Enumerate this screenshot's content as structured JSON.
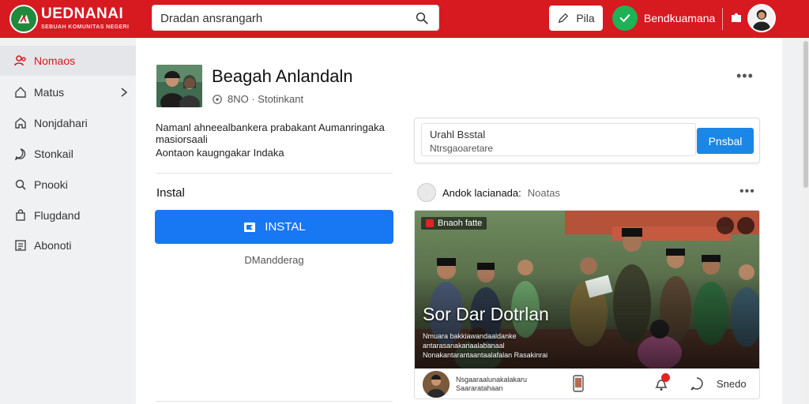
{
  "header": {
    "logo_title": "UEDNANAI",
    "logo_sub": "SEBUAH KOMUNITAS NEGERI",
    "search_placeholder": "Dradan ansrangarh",
    "pin_label": "Pila",
    "status_label": "Bendkuamana",
    "accent_color": "#d71920"
  },
  "sidebar": {
    "items": [
      {
        "label": "Nomaos",
        "icon": "people-icon",
        "active": true
      },
      {
        "label": "Matus",
        "icon": "home-icon",
        "active": false
      },
      {
        "label": "Nonjdahari",
        "icon": "house-icon",
        "active": false
      },
      {
        "label": "Stonkail",
        "icon": "chat-icon",
        "active": false
      },
      {
        "label": "Pnooki",
        "icon": "search-icon",
        "active": false
      },
      {
        "label": "Flugdand",
        "icon": "bag-icon",
        "active": false
      },
      {
        "label": "Abonoti",
        "icon": "list-icon",
        "active": false
      }
    ]
  },
  "profile": {
    "name": "Beagah Anlandaln",
    "meta": "8NO · Stotinkant",
    "bio_line1": "Namanl ahneealbankera prabakant Aumanringaka masiorsaali",
    "bio_line2": "Aontaon kaugngakar Indaka",
    "install_heading": "Instal",
    "install_button": "INSTAL",
    "install_sub": "DMandderag"
  },
  "composer": {
    "title": "Urahl Bsstal",
    "subtitle": "Ntrsgaoaretare",
    "button": "Pnsbal"
  },
  "feed": {
    "author": "Andok lacianada:",
    "author_sub": "Noatas",
    "card_tag": "Bnaoh fatte",
    "headline": "Sor Dar Dotrlan",
    "caption": "Nmuara bakkiawandaaldanke antarasanakanaalabanaal Nonakantarantaantaalafalan Rasakinrai",
    "foot_text": "Nsgaaraalunakalakaru Saararatahaan",
    "share_label": "Snedo"
  }
}
